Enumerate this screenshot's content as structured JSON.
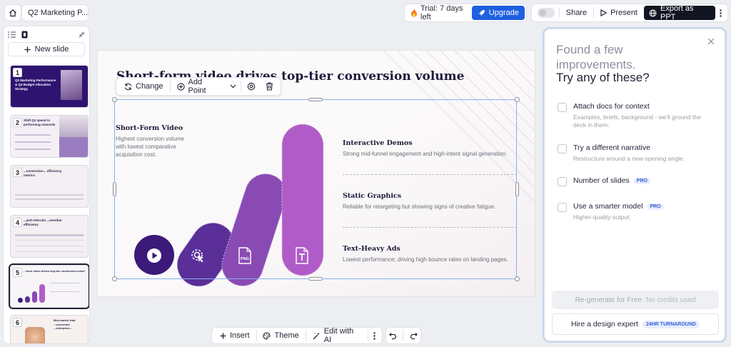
{
  "header": {
    "doc_title": "Q2 Marketing P...",
    "trial_text": "Trial: 7 days left",
    "upgrade_label": "Upgrade",
    "share_label": "Share",
    "present_label": "Present",
    "export_label": "Export as PPT"
  },
  "sidebar": {
    "new_slide_label": "New slide",
    "thumbs": [
      {
        "num": "1",
        "text": "Q2 Marketing Performance & Q3 Budget Allocation Strategy"
      },
      {
        "num": "2",
        "text": "Shift Q3 spend to performing channels"
      },
      {
        "num": "3",
        "text": "...conversion... efficiency metrics"
      },
      {
        "num": "4",
        "text": "...and referrals ...overdue efficiency"
      },
      {
        "num": "5",
        "text": "...form video drives top-tier conversion volume"
      },
      {
        "num": "6",
        "text": "Mid-market lead ...converted ...enterprise..."
      }
    ]
  },
  "slide": {
    "title": "Short-form video drives top-tier conversion volume",
    "toolbar": {
      "change_label": "Change",
      "add_point_label": "Add Point"
    },
    "left_item": {
      "title": "Short-Form Video",
      "desc": "Highest conversion volume with lowest comparative acquisition cost."
    },
    "items": [
      {
        "title": "Interactive Demos",
        "desc": "Strong mid-funnel engagement and high-intent signal generation."
      },
      {
        "title": "Static Graphics",
        "desc": "Reliable for retargeting but showing signs of creative fatigue."
      },
      {
        "title": "Text-Heavy Ads",
        "desc": "Lowest performance; driving high bounce rates on landing pages."
      }
    ],
    "pill_colors": [
      "#3b1a7a",
      "#5a2f98",
      "#8a4ab4",
      "#b05cc8"
    ],
    "pill_icons": [
      "play-icon",
      "click-icon",
      "png-file-icon",
      "text-file-icon"
    ]
  },
  "bottom": {
    "insert_label": "Insert",
    "theme_label": "Theme",
    "edit_ai_label": "Edit with AI"
  },
  "panel": {
    "heading_muted": "Found a few improvements.",
    "heading": "Try any of these?",
    "options": [
      {
        "title": "Attach docs for context",
        "sub": "Examples, briefs, background - we'll ground the deck in them."
      },
      {
        "title": "Try a different narrative",
        "sub": "Restructure around a new opening angle."
      },
      {
        "title": "Number of slides",
        "badge": "PRO"
      },
      {
        "title": "Use a smarter model",
        "badge": "PRO",
        "sub": "Higher-quality output."
      }
    ],
    "regen_label": "Re-generate for Free",
    "regen_note": "No credits used",
    "hire_label": "Hire a design expert",
    "hire_badge": "24HR TURNAROUND"
  }
}
